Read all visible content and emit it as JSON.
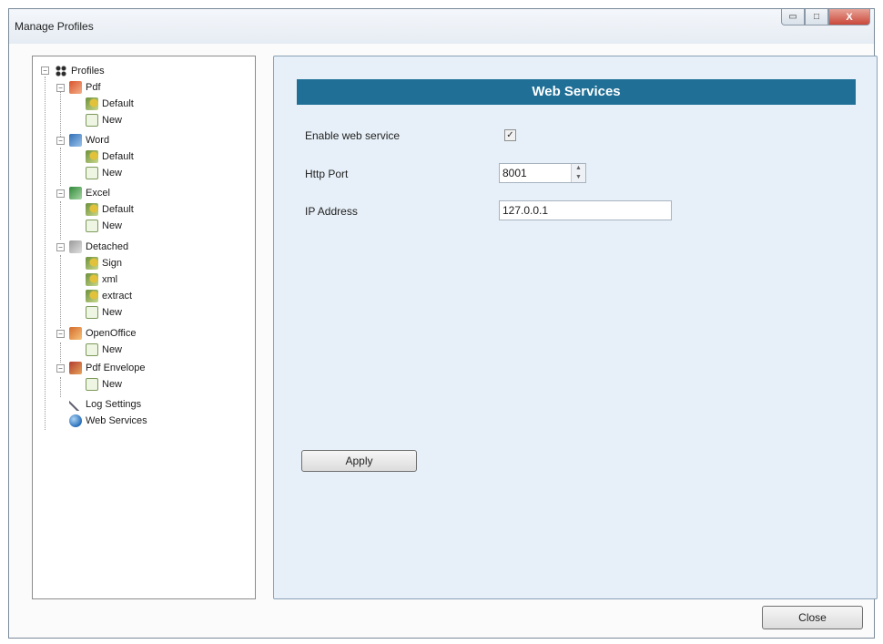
{
  "window": {
    "title": "Manage Profiles",
    "controls": {
      "minimize": "▭",
      "maximize": "□",
      "close": "X"
    }
  },
  "tree": {
    "root": "Profiles",
    "pdf": {
      "label": "Pdf",
      "children": [
        "Default",
        "New"
      ]
    },
    "word": {
      "label": "Word",
      "children": [
        "Default",
        "New"
      ]
    },
    "excel": {
      "label": "Excel",
      "children": [
        "Default",
        "New"
      ]
    },
    "detached": {
      "label": "Detached",
      "children": [
        "Sign",
        "xml",
        "extract",
        "New"
      ]
    },
    "openoffice": {
      "label": "OpenOffice",
      "children": [
        "New"
      ]
    },
    "pdf_envelope": {
      "label": "Pdf Envelope",
      "children": [
        "New"
      ]
    },
    "log_settings": "Log Settings",
    "web_services": "Web Services",
    "expander": "−"
  },
  "panel": {
    "header": "Web Services",
    "enable_label": "Enable web service",
    "enable_checked": "✓",
    "http_port_label": "Http Port",
    "http_port_value": "8001",
    "spin_up": "▲",
    "spin_down": "▼",
    "ip_label": "IP Address",
    "ip_value": "127.0.0.1",
    "apply_label": "Apply"
  },
  "footer": {
    "close_label": "Close"
  },
  "colors": {
    "header_bg": "#1f6f96",
    "panel_bg": "#e7f0f8",
    "close_btn": "#c9483a"
  }
}
